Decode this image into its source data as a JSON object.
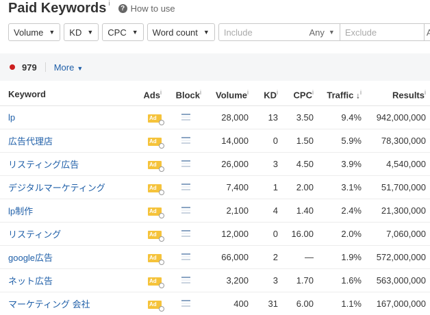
{
  "header": {
    "title": "Paid Keywords",
    "info_mark": "i",
    "help_icon": "?",
    "how_to_use": "How to use"
  },
  "filters": {
    "volume": "Volume",
    "kd": "KD",
    "cpc": "CPC",
    "word_count": "Word count",
    "include_placeholder": "Include",
    "any_label": "Any",
    "exclude_placeholder": "Exclude",
    "trailing_dropdown": "A"
  },
  "summary": {
    "count": "979",
    "more": "More"
  },
  "table": {
    "columns": {
      "keyword": "Keyword",
      "ads": "Ads",
      "block": "Block",
      "volume": "Volume",
      "kd": "KD",
      "cpc": "CPC",
      "traffic": "Traffic",
      "traffic_sort": "↓",
      "results": "Results",
      "info_mark": "i"
    },
    "ad_badge": "Ad",
    "rows": [
      {
        "keyword": "lp",
        "volume": "28,000",
        "kd": "13",
        "cpc": "3.50",
        "traffic": "9.4%",
        "results": "942,000,000"
      },
      {
        "keyword": "広告代理店",
        "volume": "14,000",
        "kd": "0",
        "cpc": "1.50",
        "traffic": "5.9%",
        "results": "78,300,000"
      },
      {
        "keyword": "リスティング広告",
        "volume": "26,000",
        "kd": "3",
        "cpc": "4.50",
        "traffic": "3.9%",
        "results": "4,540,000"
      },
      {
        "keyword": "デジタルマーケティング",
        "volume": "7,400",
        "kd": "1",
        "cpc": "2.00",
        "traffic": "3.1%",
        "results": "51,700,000"
      },
      {
        "keyword": "lp制作",
        "volume": "2,100",
        "kd": "4",
        "cpc": "1.40",
        "traffic": "2.4%",
        "results": "21,300,000"
      },
      {
        "keyword": "リスティング",
        "volume": "12,000",
        "kd": "0",
        "cpc": "16.00",
        "traffic": "2.0%",
        "results": "7,060,000"
      },
      {
        "keyword": "google広告",
        "volume": "66,000",
        "kd": "2",
        "cpc": "—",
        "traffic": "1.9%",
        "results": "572,000,000"
      },
      {
        "keyword": "ネット広告",
        "volume": "3,200",
        "kd": "3",
        "cpc": "1.70",
        "traffic": "1.6%",
        "results": "563,000,000"
      },
      {
        "keyword": "マーケティング 会社",
        "volume": "400",
        "kd": "31",
        "cpc": "6.00",
        "traffic": "1.1%",
        "results": "167,000,000"
      }
    ]
  },
  "colors": {
    "link": "#1f5fa8",
    "ad_badge": "#f5c33b",
    "status_dot": "#cc1f1f",
    "summary_bg": "#f5f6f7"
  }
}
